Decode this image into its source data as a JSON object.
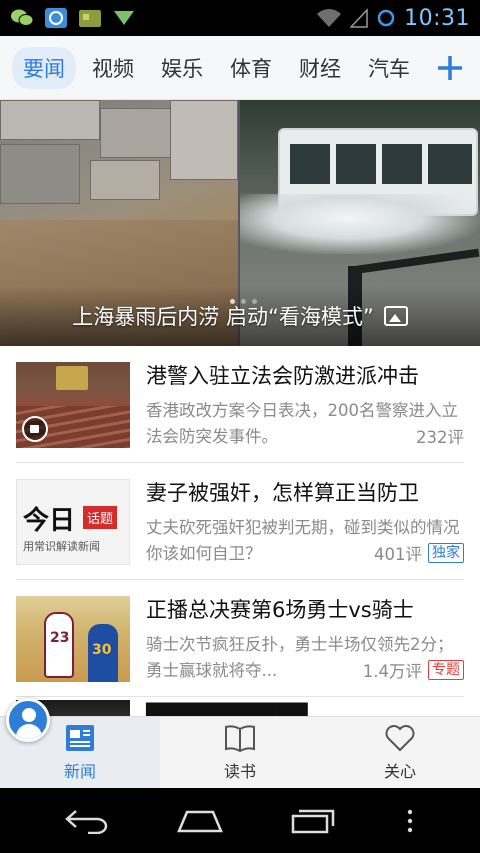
{
  "status_bar": {
    "time": "10:31",
    "left_icons": [
      "wechat-icon",
      "weibo-icon",
      "game-icon",
      "download-icon"
    ],
    "right_icons": [
      "wifi-icon",
      "signal-icon",
      "sync-icon"
    ]
  },
  "category_tabs": {
    "items": [
      "要闻",
      "视频",
      "娱乐",
      "体育",
      "财经",
      "汽车"
    ],
    "active": "要闻",
    "add_icon": "plus-icon"
  },
  "hero": {
    "caption": "上海暴雨后内涝 启动“看海模式”",
    "icon": "gallery-icon",
    "page_index": 1,
    "page_count": 3
  },
  "news": [
    {
      "title": "港警入驻立法会防激进派冲击",
      "desc": "香港政改方案今日表决，200名警察进入立法会防突发事件。",
      "comments": "232评",
      "tag": "",
      "thumb_icon": "video-icon"
    },
    {
      "title": "妻子被强奸，怎样算正当防卫",
      "desc": "丈夫砍死强奸犯被判无期，碰到类似的情况你该如何自卫？",
      "comments": "401评",
      "tag": "独家",
      "thumb_text_main": "今日",
      "thumb_text_badge": "话题",
      "thumb_text_sub": "用常识解读新闻"
    },
    {
      "title": "正播总决赛第6场勇士vs骑士",
      "desc": "骑士次节疯狂反扑，勇士半场仅领先2分；勇士赢球就将夺...",
      "comments": "1.4万评",
      "tag": "专题",
      "thumb_numbers": [
        "23",
        "30"
      ]
    },
    {
      "title": "▇▇▇▇▇▇▇▇▇▇"
    }
  ],
  "tag_colors": {
    "独家": "#2e7dd8",
    "专题": "#e0413c"
  },
  "bottom_nav": [
    {
      "label": "新闻",
      "icon": "newspaper-icon",
      "active": true
    },
    {
      "label": "读书",
      "icon": "book-icon",
      "active": false
    },
    {
      "label": "关心",
      "icon": "heart-icon",
      "active": false
    }
  ],
  "system_nav": [
    "back-icon",
    "home-icon",
    "recents-icon",
    "menu-icon"
  ],
  "colors": {
    "accent": "#2e7dd8"
  }
}
